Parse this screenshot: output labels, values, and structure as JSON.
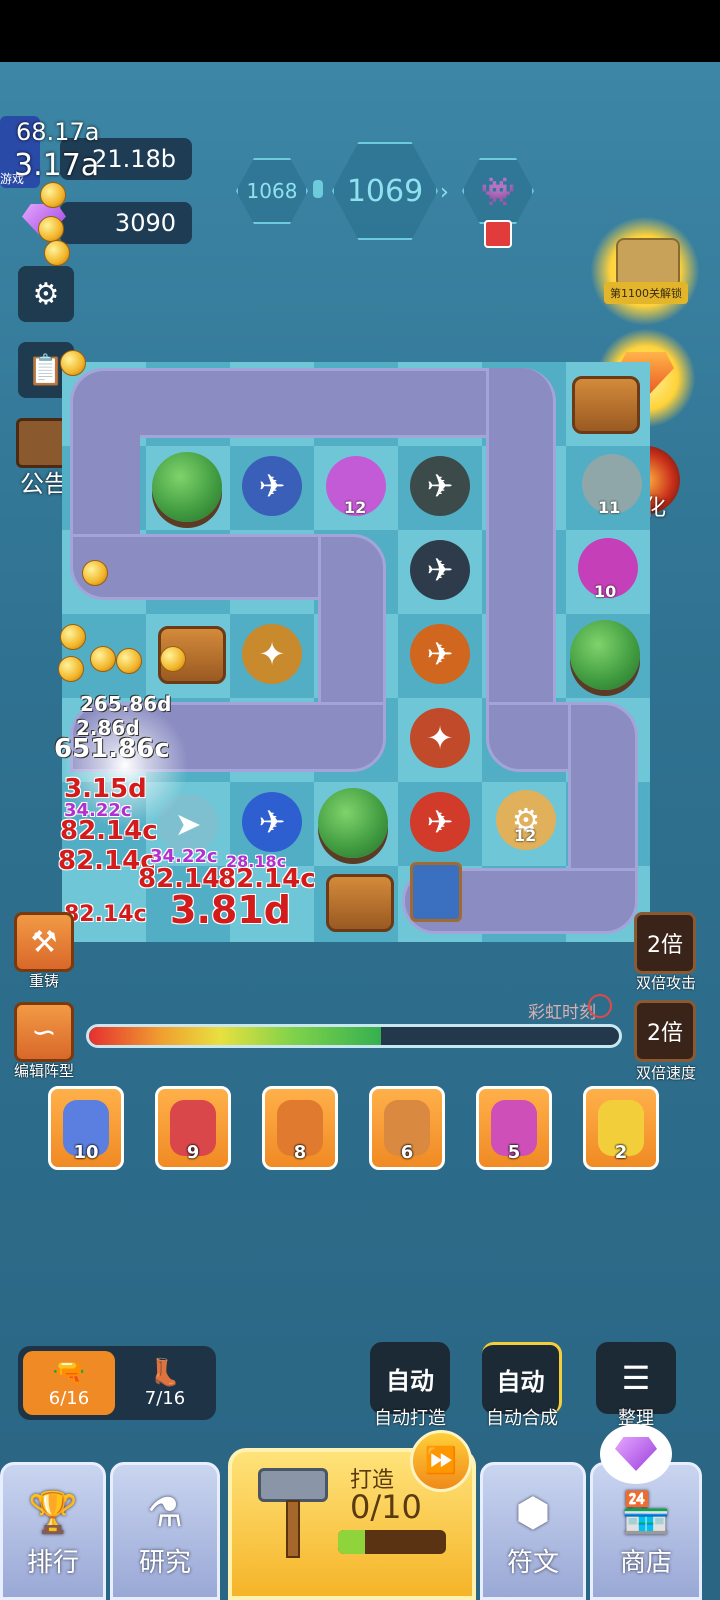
{
  "resources": {
    "gold": "21.18b",
    "gems": "3090",
    "overlay_lines": [
      "68.17a",
      "3.17a"
    ],
    "app_badge": "游戏"
  },
  "levels": {
    "prev": "1068",
    "current": "1069"
  },
  "left_buttons": {
    "notice_label": "公告"
  },
  "right_specials": {
    "unlock_label": "第1100关解锁",
    "refine_label": "炼化"
  },
  "board_tiles": {
    "t1": "12",
    "t2": "11",
    "t3": "10",
    "t4": "12"
  },
  "damage_texts": [
    "265.86d",
    "2.86d",
    "651.86c",
    "3.15d",
    "34.22c",
    "82.14c",
    "82.14c",
    "34.22c",
    "82.14c",
    "82.14c",
    "3.81d",
    "82.14c",
    "28.18c"
  ],
  "rail": {
    "recast_label": "重铸",
    "formation_label": "编辑阵型",
    "rainbow_label": "彩虹时刻",
    "double_attack_value": "2倍",
    "double_attack_label": "双倍攻击",
    "double_speed_value": "2倍",
    "double_speed_label": "双倍速度",
    "rainbow_progress": 0.55
  },
  "inventory": [
    {
      "count": "10",
      "color": "#5b7fe0"
    },
    {
      "count": "9",
      "color": "#d9474b"
    },
    {
      "count": "8",
      "color": "#e07a2e"
    },
    {
      "count": "6",
      "color": "#d98a40"
    },
    {
      "count": "5",
      "color": "#cf4fb8"
    },
    {
      "count": "2",
      "color": "#f2cf3a"
    }
  ],
  "bottom_controls": {
    "tab_a_count": "6/16",
    "tab_b_count": "7/16",
    "auto_forge_btn": "自动",
    "auto_forge_label": "自动打造",
    "auto_merge_btn": "自动",
    "auto_merge_label": "自动合成",
    "organize_label": "整理"
  },
  "nav": {
    "rank": "排行",
    "research": "研究",
    "forge_title": "打造",
    "forge_count": "0/10",
    "forge_progress": 0.25,
    "runes": "符文",
    "shop": "商店"
  }
}
